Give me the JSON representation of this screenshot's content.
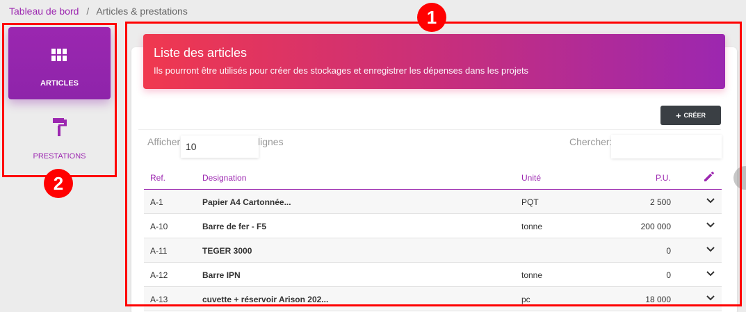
{
  "breadcrumb": {
    "home": "Tableau de bord",
    "separator": "/",
    "current": "Articles & prestations"
  },
  "sidebar": {
    "items": [
      {
        "label": "ARTICLES",
        "icon": "grid-icon",
        "active": true
      },
      {
        "label": "PRESTATIONS",
        "icon": "paint-roller-icon",
        "active": false
      }
    ]
  },
  "badges": {
    "one": "1",
    "two": "2"
  },
  "banner": {
    "title": "Liste des articles",
    "subtitle": "Ils pourront être utilisés pour créer des stockages et enregistrer les dépenses dans les projets"
  },
  "toolbar": {
    "create_label": "CRÉER"
  },
  "table_controls": {
    "show_label": "Afficher",
    "show_value": "10",
    "rows_label": "lignes",
    "search_label": "Chercher:",
    "search_value": ""
  },
  "table": {
    "headers": {
      "ref": "Ref.",
      "designation": "Designation",
      "unit": "Unité",
      "pu": "P.U."
    },
    "rows": [
      {
        "ref": "A-1",
        "designation": "Papier A4 Cartonnée...",
        "unit": "PQT",
        "pu": "2 500"
      },
      {
        "ref": "A-10",
        "designation": "Barre de fer - F5",
        "unit": "tonne",
        "pu": "200 000"
      },
      {
        "ref": "A-11",
        "designation": "TEGER 3000",
        "unit": "",
        "pu": "0"
      },
      {
        "ref": "A-12",
        "designation": "Barre IPN",
        "unit": "tonne",
        "pu": "0"
      },
      {
        "ref": "A-13",
        "designation": "cuvette + réservoir Arison 202...",
        "unit": "pc",
        "pu": "18 000"
      }
    ]
  },
  "colors": {
    "accent": "#9c27b0",
    "banner_start": "#f0384f",
    "banner_end": "#9c27b0",
    "annotation": "#ff0000",
    "button": "#3a3f44"
  }
}
